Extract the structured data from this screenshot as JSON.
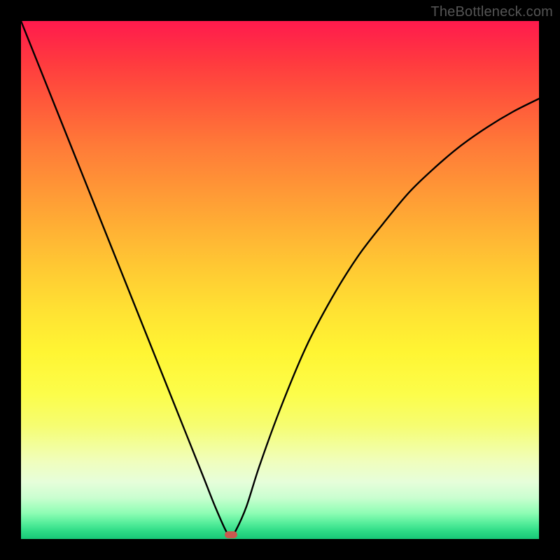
{
  "watermark": "TheBottleneck.com",
  "marker": {
    "color": "#c9594f",
    "x_frac": 0.405,
    "y_frac": 0.992
  },
  "chart_data": {
    "type": "line",
    "title": "",
    "xlabel": "",
    "ylabel": "",
    "xlim": [
      0,
      1
    ],
    "ylim": [
      0,
      1
    ],
    "series": [
      {
        "name": "bottleneck-curve",
        "x": [
          0.0,
          0.05,
          0.1,
          0.15,
          0.2,
          0.25,
          0.3,
          0.35,
          0.375,
          0.395,
          0.405,
          0.415,
          0.435,
          0.46,
          0.5,
          0.55,
          0.6,
          0.65,
          0.7,
          0.75,
          0.8,
          0.85,
          0.9,
          0.95,
          1.0
        ],
        "y": [
          1.0,
          0.875,
          0.75,
          0.625,
          0.5,
          0.375,
          0.25,
          0.125,
          0.062,
          0.017,
          0.005,
          0.017,
          0.062,
          0.14,
          0.25,
          0.37,
          0.465,
          0.545,
          0.61,
          0.67,
          0.718,
          0.76,
          0.795,
          0.825,
          0.85
        ]
      }
    ],
    "annotations": [
      {
        "name": "min-marker",
        "x": 0.405,
        "y": 0.008
      }
    ],
    "gradient_stops": [
      {
        "pos": 0.0,
        "color": "#ff1a4d"
      },
      {
        "pos": 0.5,
        "color": "#ffdd33"
      },
      {
        "pos": 0.85,
        "color": "#f4fe90"
      },
      {
        "pos": 1.0,
        "color": "#18c877"
      }
    ]
  }
}
